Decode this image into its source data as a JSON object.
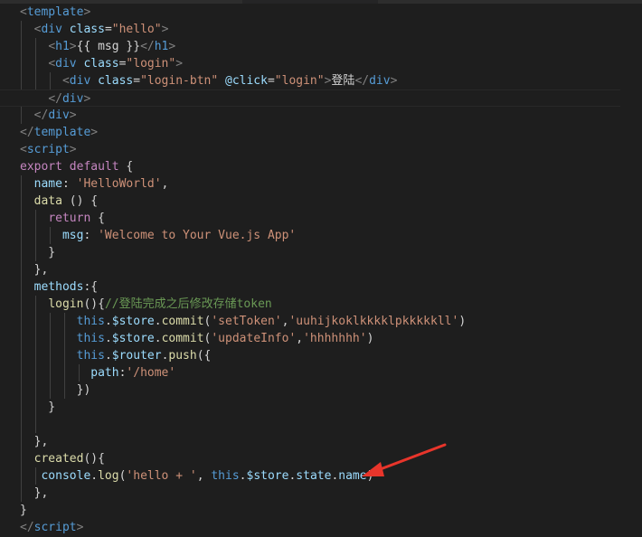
{
  "code_lines": [
    [
      [
        "pun",
        "<"
      ],
      [
        "tag",
        "template"
      ],
      [
        "pun",
        ">"
      ]
    ],
    [
      [
        "txt",
        "  "
      ],
      [
        "pun",
        "<"
      ],
      [
        "tag",
        "div"
      ],
      [
        "txt",
        " "
      ],
      [
        "attr",
        "class"
      ],
      [
        "txt",
        "="
      ],
      [
        "str",
        "\"hello\""
      ],
      [
        "pun",
        ">"
      ]
    ],
    [
      [
        "txt",
        "    "
      ],
      [
        "pun",
        "<"
      ],
      [
        "tag",
        "h1"
      ],
      [
        "pun",
        ">"
      ],
      [
        "txt",
        "{{ msg }}"
      ],
      [
        "pun",
        "</"
      ],
      [
        "tag",
        "h1"
      ],
      [
        "pun",
        ">"
      ]
    ],
    [
      [
        "txt",
        "    "
      ],
      [
        "pun",
        "<"
      ],
      [
        "tag",
        "div"
      ],
      [
        "txt",
        " "
      ],
      [
        "attr",
        "class"
      ],
      [
        "txt",
        "="
      ],
      [
        "str",
        "\"login\""
      ],
      [
        "pun",
        ">"
      ]
    ],
    [
      [
        "txt",
        "      "
      ],
      [
        "pun",
        "<"
      ],
      [
        "tag",
        "div"
      ],
      [
        "txt",
        " "
      ],
      [
        "attr",
        "class"
      ],
      [
        "txt",
        "="
      ],
      [
        "str",
        "\"login-btn\""
      ],
      [
        "txt",
        " "
      ],
      [
        "attr",
        "@click"
      ],
      [
        "txt",
        "="
      ],
      [
        "str",
        "\"login\""
      ],
      [
        "pun",
        ">"
      ],
      [
        "txt",
        "登陆"
      ],
      [
        "pun",
        "</"
      ],
      [
        "tag",
        "div"
      ],
      [
        "pun",
        ">"
      ]
    ],
    [
      [
        "txt",
        "    "
      ],
      [
        "pun",
        "</"
      ],
      [
        "tag",
        "div"
      ],
      [
        "pun",
        ">"
      ]
    ],
    [
      [
        "txt",
        "  "
      ],
      [
        "pun",
        "</"
      ],
      [
        "tag",
        "div"
      ],
      [
        "pun",
        ">"
      ]
    ],
    [
      [
        "pun",
        "</"
      ],
      [
        "tag",
        "template"
      ],
      [
        "pun",
        ">"
      ]
    ],
    [
      [
        "pun",
        "<"
      ],
      [
        "tag",
        "script"
      ],
      [
        "pun",
        ">"
      ]
    ],
    [
      [
        "kw",
        "export"
      ],
      [
        "txt",
        " "
      ],
      [
        "kw",
        "default"
      ],
      [
        "txt",
        " {"
      ]
    ],
    [
      [
        "txt",
        "  "
      ],
      [
        "prop",
        "name"
      ],
      [
        "txt",
        ": "
      ],
      [
        "str",
        "'HelloWorld'"
      ],
      [
        "txt",
        ","
      ]
    ],
    [
      [
        "txt",
        "  "
      ],
      [
        "fn",
        "data"
      ],
      [
        "txt",
        " () {"
      ]
    ],
    [
      [
        "txt",
        "    "
      ],
      [
        "kw",
        "return"
      ],
      [
        "txt",
        " {"
      ]
    ],
    [
      [
        "txt",
        "      "
      ],
      [
        "prop",
        "msg"
      ],
      [
        "txt",
        ": "
      ],
      [
        "str",
        "'Welcome to Your Vue.js App'"
      ]
    ],
    [
      [
        "txt",
        "    }"
      ]
    ],
    [
      [
        "txt",
        "  },"
      ]
    ],
    [
      [
        "txt",
        "  "
      ],
      [
        "prop",
        "methods"
      ],
      [
        "txt",
        ":{"
      ]
    ],
    [
      [
        "txt",
        "    "
      ],
      [
        "fn",
        "login"
      ],
      [
        "txt",
        "(){"
      ],
      [
        "cmt",
        "//登陆完成之后修改存储token"
      ]
    ],
    [
      [
        "txt",
        "        "
      ],
      [
        "kwb",
        "this"
      ],
      [
        "txt",
        "."
      ],
      [
        "prop",
        "$store"
      ],
      [
        "txt",
        "."
      ],
      [
        "fn",
        "commit"
      ],
      [
        "txt",
        "("
      ],
      [
        "str",
        "'setToken'"
      ],
      [
        "txt",
        ","
      ],
      [
        "str",
        "'uuhijkoklkkkklpkkkkkll'"
      ],
      [
        "txt",
        ")"
      ]
    ],
    [
      [
        "txt",
        "        "
      ],
      [
        "kwb",
        "this"
      ],
      [
        "txt",
        "."
      ],
      [
        "prop",
        "$store"
      ],
      [
        "txt",
        "."
      ],
      [
        "fn",
        "commit"
      ],
      [
        "txt",
        "("
      ],
      [
        "str",
        "'updateInfo'"
      ],
      [
        "txt",
        ","
      ],
      [
        "str",
        "'hhhhhhh'"
      ],
      [
        "txt",
        ")"
      ]
    ],
    [
      [
        "txt",
        "        "
      ],
      [
        "kwb",
        "this"
      ],
      [
        "txt",
        "."
      ],
      [
        "prop",
        "$router"
      ],
      [
        "txt",
        "."
      ],
      [
        "fn",
        "push"
      ],
      [
        "txt",
        "({"
      ]
    ],
    [
      [
        "txt",
        "          "
      ],
      [
        "prop",
        "path"
      ],
      [
        "txt",
        ":"
      ],
      [
        "str",
        "'/home'"
      ]
    ],
    [
      [
        "txt",
        "        })"
      ]
    ],
    [
      [
        "txt",
        "    }"
      ]
    ],
    [
      [
        "txt",
        ""
      ]
    ],
    [
      [
        "txt",
        "  },"
      ]
    ],
    [
      [
        "txt",
        "  "
      ],
      [
        "fn",
        "created"
      ],
      [
        "txt",
        "(){"
      ]
    ],
    [
      [
        "txt",
        "   "
      ],
      [
        "prop",
        "console"
      ],
      [
        "txt",
        "."
      ],
      [
        "fn",
        "log"
      ],
      [
        "txt",
        "("
      ],
      [
        "str",
        "'hello + '"
      ],
      [
        "txt",
        ", "
      ],
      [
        "kwb",
        "this"
      ],
      [
        "txt",
        "."
      ],
      [
        "prop",
        "$store"
      ],
      [
        "txt",
        "."
      ],
      [
        "prop",
        "state"
      ],
      [
        "txt",
        "."
      ],
      [
        "prop",
        "name"
      ],
      [
        "txt",
        ")"
      ]
    ],
    [
      [
        "txt",
        "  },"
      ]
    ],
    [
      [
        "txt",
        "}"
      ]
    ],
    [
      [
        "pun",
        "</"
      ],
      [
        "tag",
        "script"
      ],
      [
        "pun",
        ">"
      ]
    ]
  ],
  "current_line_index": 5,
  "arrow_color": "#e8352b"
}
